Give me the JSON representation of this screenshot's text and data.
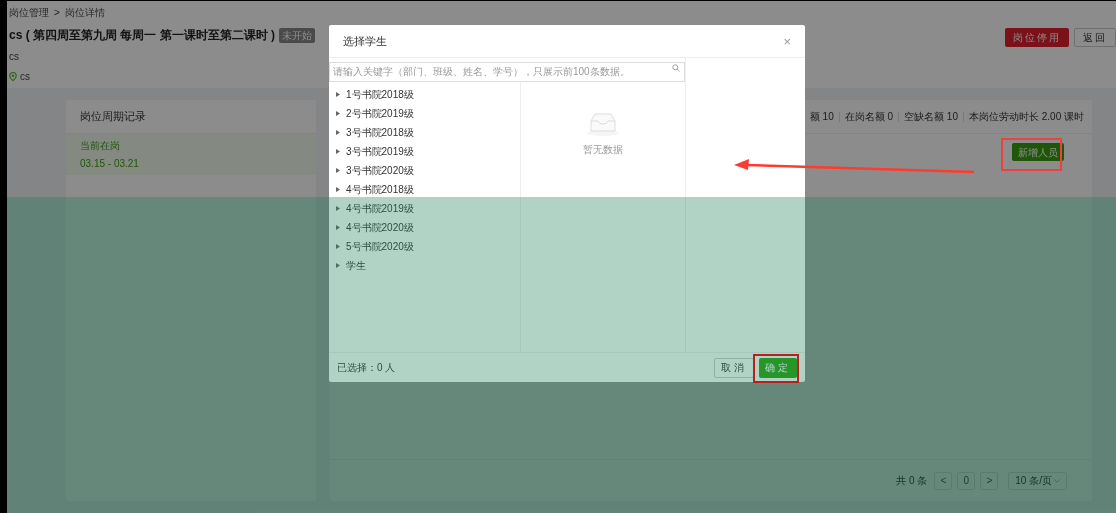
{
  "breadcrumb": {
    "items": [
      "岗位管理",
      "岗位详情"
    ],
    "separator": ">"
  },
  "title": "cs ( 第四周至第九周 每周一 第一课时至第二课时 )",
  "status_badge": "未开始",
  "subtitle": "cs",
  "location": "cs",
  "header_buttons": [
    {
      "label": "岗位停用",
      "kind": "danger"
    },
    {
      "label": "返回",
      "kind": "default"
    }
  ],
  "cycle_panel": {
    "title": "岗位周期记录",
    "items": [
      {
        "title": "当前在岗",
        "dates": "03.15 - 03.21",
        "selected": true
      }
    ]
  },
  "stats": [
    "额 10",
    "在岗名额 0",
    "空缺名额 10",
    "本岗位劳动时长 2.00 课时"
  ],
  "add_button": "新增人员",
  "pagination": {
    "total": "共 0 条",
    "prev": "<",
    "page": "0",
    "next": ">",
    "page_size": "10 条/页"
  },
  "dialog": {
    "title": "选择学生",
    "close": "×",
    "search": {
      "placeholder": "请输入关键字（部门、班级、姓名、学号），只展示前100条数据。"
    },
    "tree": [
      {
        "label": "1号书院2018级",
        "expanded": false
      },
      {
        "label": "2号书院2019级",
        "expanded": false
      },
      {
        "label": "3号书院2018级",
        "expanded": false
      },
      {
        "label": "3号书院2019级",
        "expanded": false
      },
      {
        "label": "3号书院2020级",
        "expanded": false
      },
      {
        "label": "4号书院2018级",
        "expanded": false
      },
      {
        "label": "4号书院2019级",
        "expanded": false
      },
      {
        "label": "4号书院2020级",
        "expanded": false
      },
      {
        "label": "5号书院2020级",
        "expanded": false
      },
      {
        "label": "学生",
        "expanded": false
      }
    ],
    "empty_text": "暂无数据",
    "selected_count": "已选择：0 人",
    "buttons": [
      {
        "label": "取消",
        "kind": "default"
      },
      {
        "label": "确定",
        "kind": "primary"
      }
    ]
  }
}
